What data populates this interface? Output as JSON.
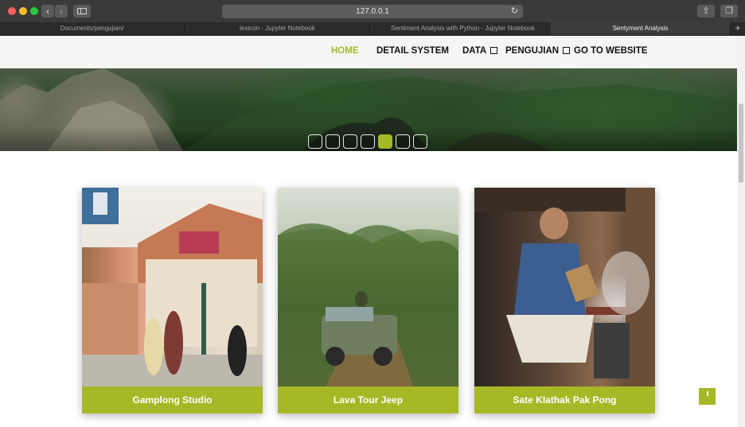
{
  "browser": {
    "url": "127.0.0.1",
    "tabs": [
      {
        "label": "Documents/pengujian/",
        "active": false
      },
      {
        "label": "lexicon - Jupyter Notebook",
        "active": false
      },
      {
        "label": "Sentiment Analysis with Python - Jupyter Notebook",
        "active": false
      },
      {
        "label": "Sentyment Analysis",
        "active": true
      }
    ],
    "new_tab_symbol": "+"
  },
  "nav": {
    "home": "HOME",
    "detail_system": "DETAIL SYSTEM",
    "data": "DATA",
    "pengujian": "PENGUJIAN",
    "go_to_website": "GO TO WEBSITE"
  },
  "slider": {
    "dot_count": 7,
    "active_index": 4
  },
  "cards": [
    {
      "label": "Gamplong Studio"
    },
    {
      "label": "Lava Tour Jeep"
    },
    {
      "label": "Sate Klathak Pak Pong"
    }
  ],
  "colors": {
    "accent": "#a6b826",
    "nav_bg": "#f5f5f5",
    "text": "#111111"
  },
  "icons": {
    "back": "chevron-left-icon",
    "forward": "chevron-right-icon",
    "sidebar": "sidebar-icon",
    "reload": "reload-icon",
    "share": "share-icon",
    "tabs_overview": "tabs-icon",
    "dropdown": "dropdown-caret-icon",
    "back_to_top": "back-to-top-icon"
  }
}
